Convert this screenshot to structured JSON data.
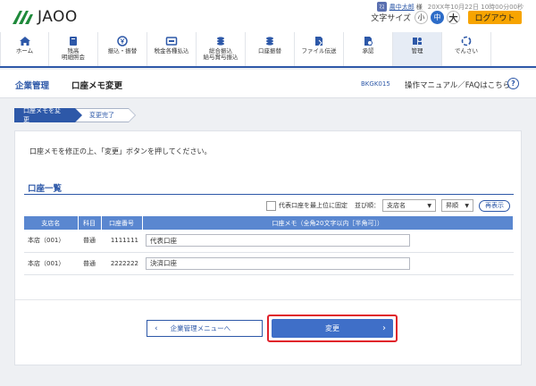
{
  "brand": {
    "logo_text": "JAOO",
    "accent": "#2d58a8",
    "logout_color": "#f7a400",
    "highlight": "#e0202a"
  },
  "user": {
    "icon": "ﾏｽ",
    "name": "農中太郎",
    "suffix": "様",
    "login_time": "20XX年10月22日 10時00分00秒"
  },
  "font_size": {
    "label": "文字サイズ",
    "small": "小",
    "medium": "中",
    "large": "大"
  },
  "logout": "ログアウト",
  "nav": [
    {
      "label": "ホーム",
      "icon": "home-icon"
    },
    {
      "label": "残高\n明細照会",
      "icon": "passbook-icon"
    },
    {
      "label": "振込・振替",
      "icon": "yen-transfer-icon"
    },
    {
      "label": "税金各種払込",
      "icon": "payment-icon"
    },
    {
      "label": "総合振込\n給与賞与振込",
      "icon": "coins-icon"
    },
    {
      "label": "口座振替",
      "icon": "coins-icon"
    },
    {
      "label": "ファイル伝送",
      "icon": "file-icon"
    },
    {
      "label": "承認",
      "icon": "approval-icon"
    },
    {
      "label": "管理",
      "icon": "admin-icon"
    },
    {
      "label": "でんさい",
      "icon": "densai-icon"
    }
  ],
  "page": {
    "category": "企業管理",
    "title": "口座メモ変更",
    "id": "BKGK015",
    "help": "操作マニュアル／FAQはこちら",
    "help_icon": "?"
  },
  "steps": [
    "口座メモを変更",
    "変更完了"
  ],
  "instruction": "口座メモを修正の上、「変更」ボタンを押してください。",
  "section_title": "口座一覧",
  "filter": {
    "checkbox_label": "代表口座を最上位に固定",
    "sort_label": "並び順：",
    "sort_value": "支店名",
    "order_value": "昇順",
    "redisplay": "再表示"
  },
  "table": {
    "headers": [
      "支店名",
      "科目",
      "口座番号",
      "口座メモ（全角20文字以内［半角可］）"
    ],
    "rows": [
      {
        "branch": "本店（001）",
        "subject": "普通",
        "number": "1111111",
        "memo": "代表口座"
      },
      {
        "branch": "本店（001）",
        "subject": "普通",
        "number": "2222222",
        "memo": "決済口座"
      }
    ]
  },
  "buttons": {
    "back": "企業管理メニューへ",
    "submit": "変更"
  }
}
